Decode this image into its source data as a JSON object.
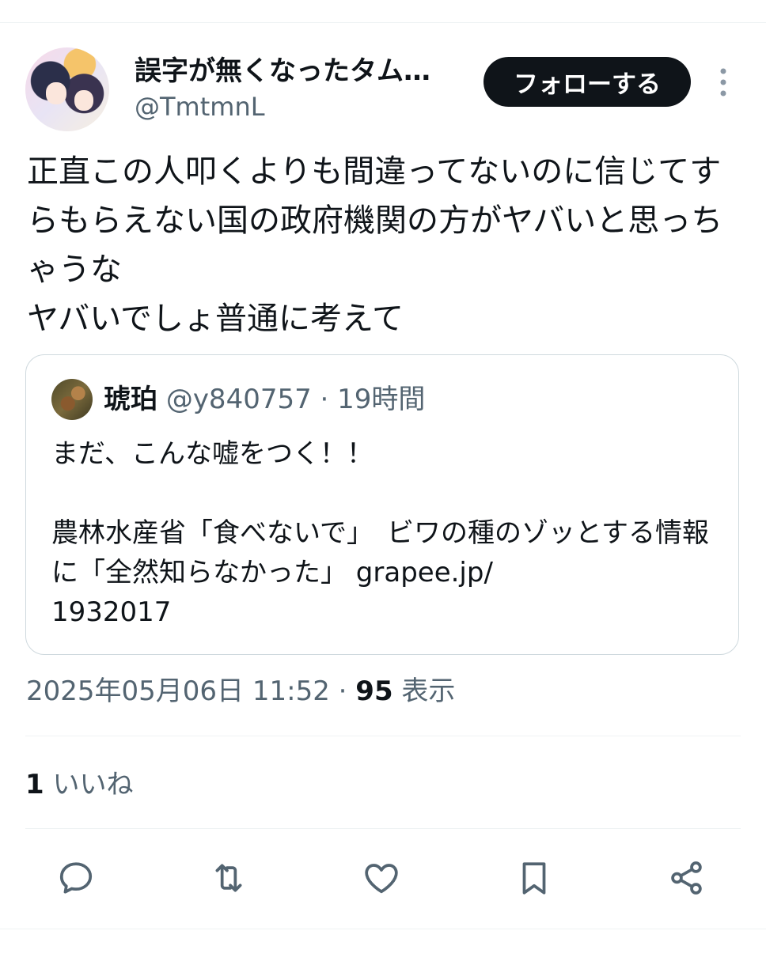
{
  "author": {
    "display_name": "誤字が無くなったタム…",
    "handle": "@TmtmnL"
  },
  "follow_label": "フォローする",
  "tweet_text": "正直この人叩くよりも間違ってないのに信じてすらもらえない国の政府機関の方がヤバいと思っちゃうな\nヤバいでしょ普通に考えて",
  "quote": {
    "name": "琥珀",
    "handle": "@y840757",
    "separator": " · ",
    "time": "19時間",
    "text": "まだ、こんな嘘をつく！！\n\n農林水産省「食べないで」　ビワの種のゾッとする情報に「全然知らなかった」 grapee.jp/\n1932017"
  },
  "meta": {
    "timestamp": "2025年05月06日 11:52",
    "separator": " · ",
    "views_count": "95",
    "views_label": " 表示"
  },
  "likes": {
    "count": "1",
    "label": " いいね"
  },
  "actions": {
    "reply_icon": "reply-icon",
    "retweet_icon": "retweet-icon",
    "like_icon": "heart-icon",
    "bookmark_icon": "bookmark-icon",
    "share_icon": "share-icon"
  },
  "colors": {
    "text": "#0f1419",
    "secondary": "#536471",
    "border": "#cfd9de",
    "divider": "#eff3f4"
  }
}
